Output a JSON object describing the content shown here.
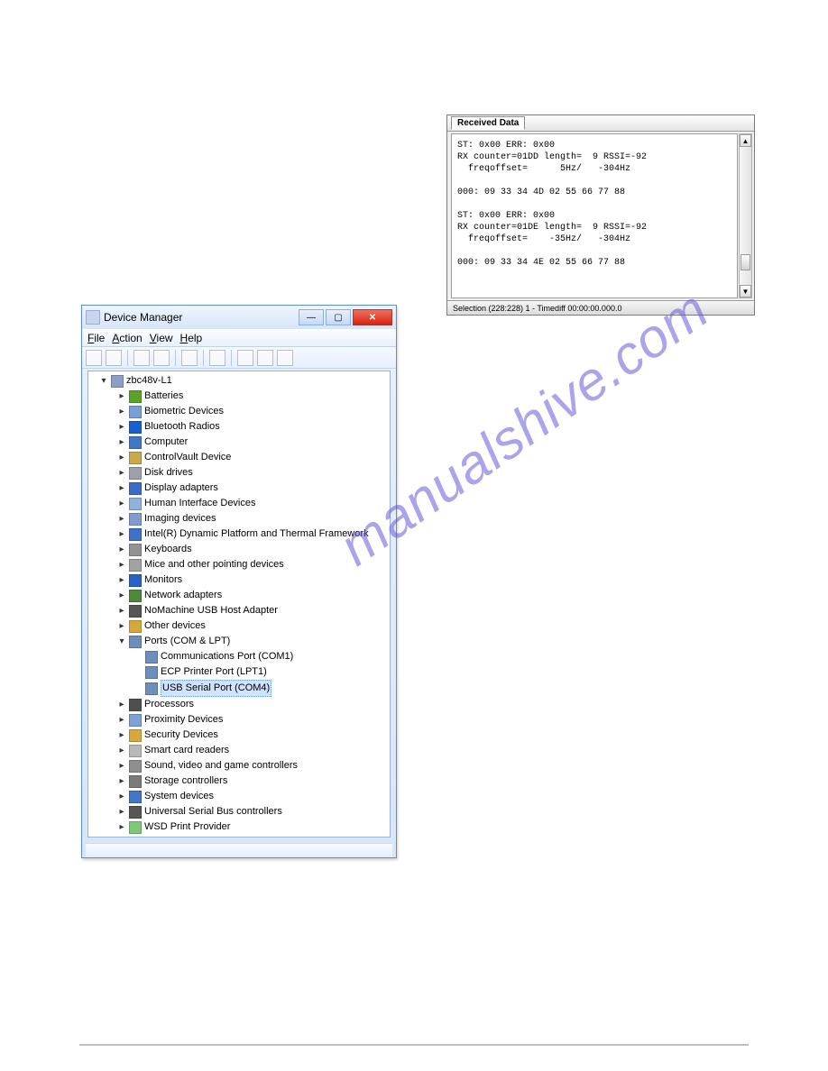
{
  "watermark": "manualshive.com",
  "deviceManager": {
    "title": "Device Manager",
    "menus": [
      "File",
      "Action",
      "View",
      "Help"
    ],
    "root": "zbc48v-L1",
    "nodes": [
      {
        "label": "Batteries",
        "iconColor": "#5aa327"
      },
      {
        "label": "Biometric Devices",
        "iconColor": "#7a9ed6"
      },
      {
        "label": "Bluetooth Radios",
        "iconColor": "#1a5fd2"
      },
      {
        "label": "Computer",
        "iconColor": "#4276c9"
      },
      {
        "label": "ControlVault Device",
        "iconColor": "#caa84d"
      },
      {
        "label": "Disk drives",
        "iconColor": "#9da1aa"
      },
      {
        "label": "Display adapters",
        "iconColor": "#3b6dc8"
      },
      {
        "label": "Human Interface Devices",
        "iconColor": "#8fb2da"
      },
      {
        "label": "Imaging devices",
        "iconColor": "#7f9bcf"
      },
      {
        "label": "Intel(R) Dynamic Platform and Thermal Framework",
        "iconColor": "#3f71c7"
      },
      {
        "label": "Keyboards",
        "iconColor": "#939393"
      },
      {
        "label": "Mice and other pointing devices",
        "iconColor": "#a2a2a2"
      },
      {
        "label": "Monitors",
        "iconColor": "#2b62c5"
      },
      {
        "label": "Network adapters",
        "iconColor": "#4c8a3a"
      },
      {
        "label": "NoMachine USB Host Adapter",
        "iconColor": "#565656"
      },
      {
        "label": "Other devices",
        "iconColor": "#d2aa3c"
      }
    ],
    "portsNode": {
      "label": "Ports (COM & LPT)"
    },
    "ports": [
      {
        "label": "Communications Port (COM1)"
      },
      {
        "label": "ECP Printer Port (LPT1)"
      },
      {
        "label": "USB Serial Port (COM4)",
        "selected": true
      }
    ],
    "nodesAfter": [
      {
        "label": "Processors",
        "iconColor": "#4f4f4f"
      },
      {
        "label": "Proximity Devices",
        "iconColor": "#7da1d8"
      },
      {
        "label": "Security Devices",
        "iconColor": "#d7a83d"
      },
      {
        "label": "Smart card readers",
        "iconColor": "#b8b8b8"
      },
      {
        "label": "Sound, video and game controllers",
        "iconColor": "#8f8f8f"
      },
      {
        "label": "Storage controllers",
        "iconColor": "#7b7b7b"
      },
      {
        "label": "System devices",
        "iconColor": "#4276c9"
      },
      {
        "label": "Universal Serial Bus controllers",
        "iconColor": "#565656"
      },
      {
        "label": "WSD Print Provider",
        "iconColor": "#7dc977"
      }
    ]
  },
  "receivedData": {
    "tabLabel": "Received Data",
    "lines": [
      "ST: 0x00 ERR: 0x00",
      "RX counter=01DD length=  9 RSSI=-92",
      "  freqoffset=      5Hz/   -304Hz",
      "",
      "000: 09 33 34 4D 02 55 66 77 88",
      "",
      "ST: 0x00 ERR: 0x00",
      "RX counter=01DE length=  9 RSSI=-92",
      "  freqoffset=    -35Hz/   -304Hz",
      "",
      "000: 09 33 34 4E 02 55 66 77 88"
    ],
    "status": "Selection (228:228) 1 - Timediff 00:00:00.000.0"
  },
  "footerLink": ""
}
